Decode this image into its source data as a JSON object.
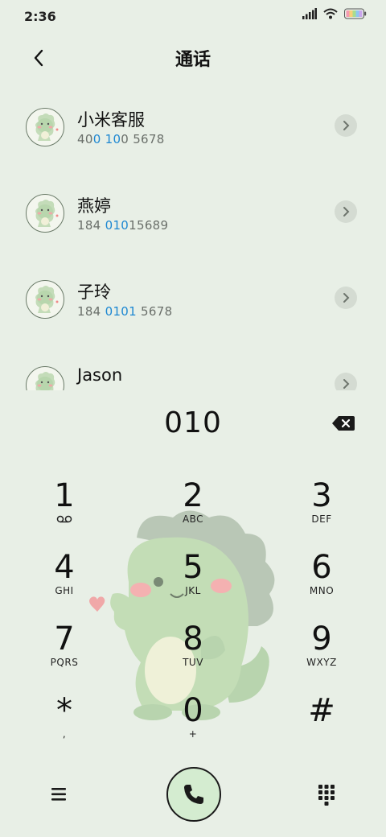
{
  "status": {
    "time": "2:36"
  },
  "header": {
    "title": "通话"
  },
  "contacts": [
    {
      "name": "小米客服",
      "num_parts": [
        "40",
        "0 10",
        "0 5678"
      ]
    },
    {
      "name": "燕婷",
      "num_parts": [
        "184 ",
        "010",
        "15689"
      ]
    },
    {
      "name": "子玲",
      "num_parts": [
        "184 ",
        "0101",
        " 5678"
      ]
    },
    {
      "name": "Jason",
      "num_parts": [
        "",
        "",
        ""
      ]
    }
  ],
  "dialer": {
    "input": "010",
    "keys": [
      {
        "digit": "1",
        "letters": ""
      },
      {
        "digit": "2",
        "letters": "ABC"
      },
      {
        "digit": "3",
        "letters": "DEF"
      },
      {
        "digit": "4",
        "letters": "GHI"
      },
      {
        "digit": "5",
        "letters": "JKL"
      },
      {
        "digit": "6",
        "letters": "MNO"
      },
      {
        "digit": "7",
        "letters": "PQRS"
      },
      {
        "digit": "8",
        "letters": "TUV"
      },
      {
        "digit": "9",
        "letters": "WXYZ"
      },
      {
        "digit": "*",
        "letters": ","
      },
      {
        "digit": "0",
        "letters": "+"
      },
      {
        "digit": "#",
        "letters": ""
      }
    ]
  },
  "icons": {
    "back": "chevron-left-icon",
    "backspace": "backspace-icon",
    "voicemail": "voicemail-icon",
    "menu": "hamburger-menu-icon",
    "call": "phone-icon",
    "keypad": "dialpad-icon"
  },
  "colors": {
    "background": "#e8efe6",
    "highlight": "#1e88d2",
    "call_button": "#d4ecd0"
  }
}
